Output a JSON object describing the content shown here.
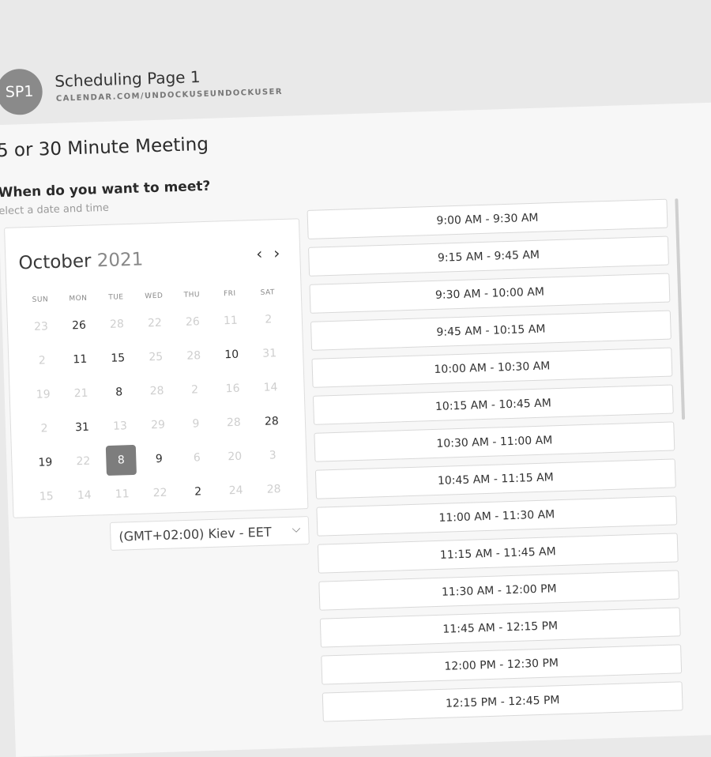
{
  "header": {
    "avatar_initials": "SP1",
    "title": "Scheduling Page 1",
    "subtitle": "CALENDAR.COM/UNDOCKUSEUNDOCKUSER"
  },
  "meeting": {
    "title": "5 or 30 Minute Meeting",
    "question": "When do you want to meet?",
    "hint": "elect a date and time"
  },
  "calendar": {
    "month": "October",
    "year": "2021",
    "prev_icon": "‹",
    "next_icon": "›",
    "weekdays": [
      "SUN",
      "MON",
      "TUE",
      "WED",
      "THU",
      "FRI",
      "SAT"
    ],
    "rows": [
      [
        {
          "d": "23",
          "s": "muted"
        },
        {
          "d": "26",
          "s": "active"
        },
        {
          "d": "28",
          "s": "muted"
        },
        {
          "d": "22",
          "s": "muted"
        },
        {
          "d": "26",
          "s": "muted"
        },
        {
          "d": "11",
          "s": "muted"
        },
        {
          "d": "2",
          "s": "muted"
        }
      ],
      [
        {
          "d": "2",
          "s": "muted"
        },
        {
          "d": "11",
          "s": "active"
        },
        {
          "d": "15",
          "s": "active"
        },
        {
          "d": "25",
          "s": "muted"
        },
        {
          "d": "28",
          "s": "muted"
        },
        {
          "d": "10",
          "s": "active"
        },
        {
          "d": "31",
          "s": "muted"
        }
      ],
      [
        {
          "d": "19",
          "s": "muted"
        },
        {
          "d": "21",
          "s": "muted"
        },
        {
          "d": "8",
          "s": "active"
        },
        {
          "d": "28",
          "s": "muted"
        },
        {
          "d": "2",
          "s": "muted"
        },
        {
          "d": "16",
          "s": "muted"
        },
        {
          "d": "14",
          "s": "muted"
        }
      ],
      [
        {
          "d": "2",
          "s": "muted"
        },
        {
          "d": "31",
          "s": "active"
        },
        {
          "d": "13",
          "s": "muted"
        },
        {
          "d": "29",
          "s": "muted"
        },
        {
          "d": "9",
          "s": "muted"
        },
        {
          "d": "28",
          "s": "muted"
        },
        {
          "d": "28",
          "s": "active"
        }
      ],
      [
        {
          "d": "19",
          "s": "active"
        },
        {
          "d": "22",
          "s": "muted"
        },
        {
          "d": "8",
          "s": "selected"
        },
        {
          "d": "9",
          "s": "active"
        },
        {
          "d": "6",
          "s": "muted"
        },
        {
          "d": "20",
          "s": "muted"
        },
        {
          "d": "3",
          "s": "muted"
        }
      ],
      [
        {
          "d": "15",
          "s": "muted"
        },
        {
          "d": "14",
          "s": "muted"
        },
        {
          "d": "11",
          "s": "muted"
        },
        {
          "d": "22",
          "s": "muted"
        },
        {
          "d": "2",
          "s": "active"
        },
        {
          "d": "24",
          "s": "muted"
        },
        {
          "d": "28",
          "s": "muted"
        }
      ]
    ]
  },
  "timezone": {
    "value": "(GMT+02:00) Kiev - EET",
    "chevron_icon": "⌵"
  },
  "slots": [
    "9:00 AM - 9:30 AM",
    "9:15 AM - 9:45 AM",
    "9:30 AM - 10:00 AM",
    "9:45 AM - 10:15 AM",
    "10:00 AM - 10:30 AM",
    "10:15 AM - 10:45 AM",
    "10:30 AM - 11:00 AM",
    "10:45 AM - 11:15 AM",
    "11:00 AM - 11:30 AM",
    "11:15 AM - 11:45 AM",
    "11:30 AM - 12:00 PM",
    "11:45 AM - 12:15 PM",
    "12:00 PM - 12:30 PM",
    "12:15 PM - 12:45 PM"
  ]
}
